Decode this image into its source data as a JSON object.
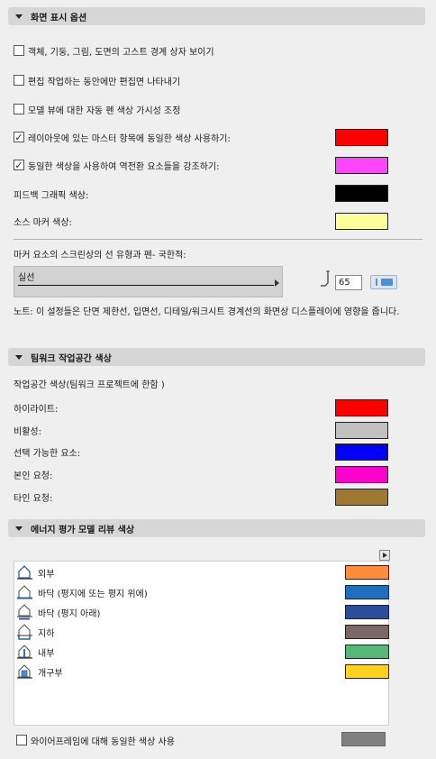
{
  "display": {
    "header": "화면 표시 옵션",
    "checkboxes": [
      {
        "label": "객체, 기둥, 그림, 도면의 고스트 경계 상자 보이기",
        "checked": false
      },
      {
        "label": "편집 작업하는 동안에만 편집면 나타내기",
        "checked": false
      },
      {
        "label": "모델 뷰에 대한 자동 펜 색상 가시성 조정",
        "checked": false
      },
      {
        "label": "레이아웃에 있는 마스터 항목에 동일한 색상 사용하기:",
        "checked": true,
        "color": "#ff0000"
      },
      {
        "label": "동일한 색상을 사용하여 역전환 요소들을 강조하기:",
        "checked": true,
        "color": "#ff44ff"
      }
    ],
    "check_mark": "✓",
    "feedback_label": "피드백 그래픽 색상:",
    "feedback_color": "#000000",
    "source_marker_label": "소스 마커 색상:",
    "source_marker_color": "#ffff99",
    "marker_line_label": "마커 요소의 스크린상의 선 유형과 펜- 국한적:",
    "line_type": "실선",
    "pen_number": "65",
    "note": "노트: 이 설정들은 단면 제한선, 입면선, 디테일/워크시트 경계선의 화면상 디스플레이에 영향을 줍니다."
  },
  "teamwork": {
    "header": "팀워크 작업공간 색상",
    "subtitle": "작업공간 색상(팀워크 프로젝트에 한함 )",
    "items": [
      {
        "label": "하이라이트:",
        "color": "#ff0000"
      },
      {
        "label": "비활성:",
        "color": "#c0c0c0"
      },
      {
        "label": "선택 가능한 요소:",
        "color": "#0000ff"
      },
      {
        "label": "본인 요청:",
        "color": "#ff00cc"
      },
      {
        "label": "타인 요청:",
        "color": "#a07830"
      }
    ]
  },
  "energy": {
    "header": "에너지 평가 모델 리뷰 색상",
    "items": [
      {
        "label": "외부",
        "icon": "building-exterior-icon",
        "color": "#ff8c3a"
      },
      {
        "label": "바닥 (평지에 또는 평지 위에)",
        "icon": "building-floor-on-grade-icon",
        "color": "#1f6fc0"
      },
      {
        "label": "바닥 (평지 아래)",
        "icon": "building-floor-below-grade-icon",
        "color": "#2c4c9c"
      },
      {
        "label": "지하",
        "icon": "building-underground-icon",
        "color": "#7a6868"
      },
      {
        "label": "내부",
        "icon": "building-interior-icon",
        "color": "#56b878"
      },
      {
        "label": "개구부",
        "icon": "building-opening-icon",
        "color": "#ffd21e"
      }
    ],
    "wireframe_label": "와이어프레임에 대해 동일한 색상 사용",
    "wireframe_checked": false,
    "wireframe_color": "#808080"
  }
}
